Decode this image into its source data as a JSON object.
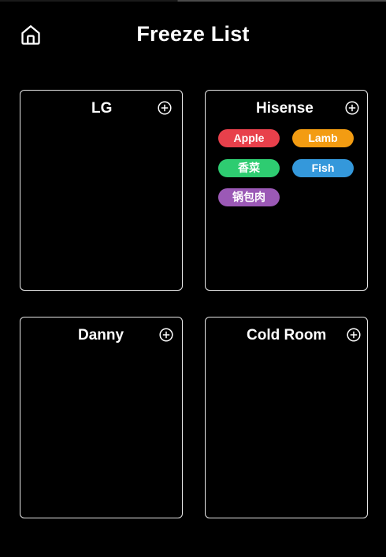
{
  "header": {
    "title": "Freeze List",
    "home_icon": "home-icon"
  },
  "freezers": [
    {
      "name": "LG",
      "add_icon": "add-circle-icon",
      "items": []
    },
    {
      "name": "Hisense",
      "add_icon": "add-circle-icon",
      "items": [
        {
          "label": "Apple",
          "color": "#e8404b"
        },
        {
          "label": "Lamb",
          "color": "#f39c12"
        },
        {
          "label": "香菜",
          "color": "#2ecc71"
        },
        {
          "label": "Fish",
          "color": "#3498db"
        },
        {
          "label": "锅包肉",
          "color": "#9b59b6"
        }
      ]
    },
    {
      "name": "Danny",
      "add_icon": "add-circle-icon",
      "items": []
    },
    {
      "name": "Cold Room",
      "add_icon": "add-circle-icon",
      "items": []
    }
  ]
}
